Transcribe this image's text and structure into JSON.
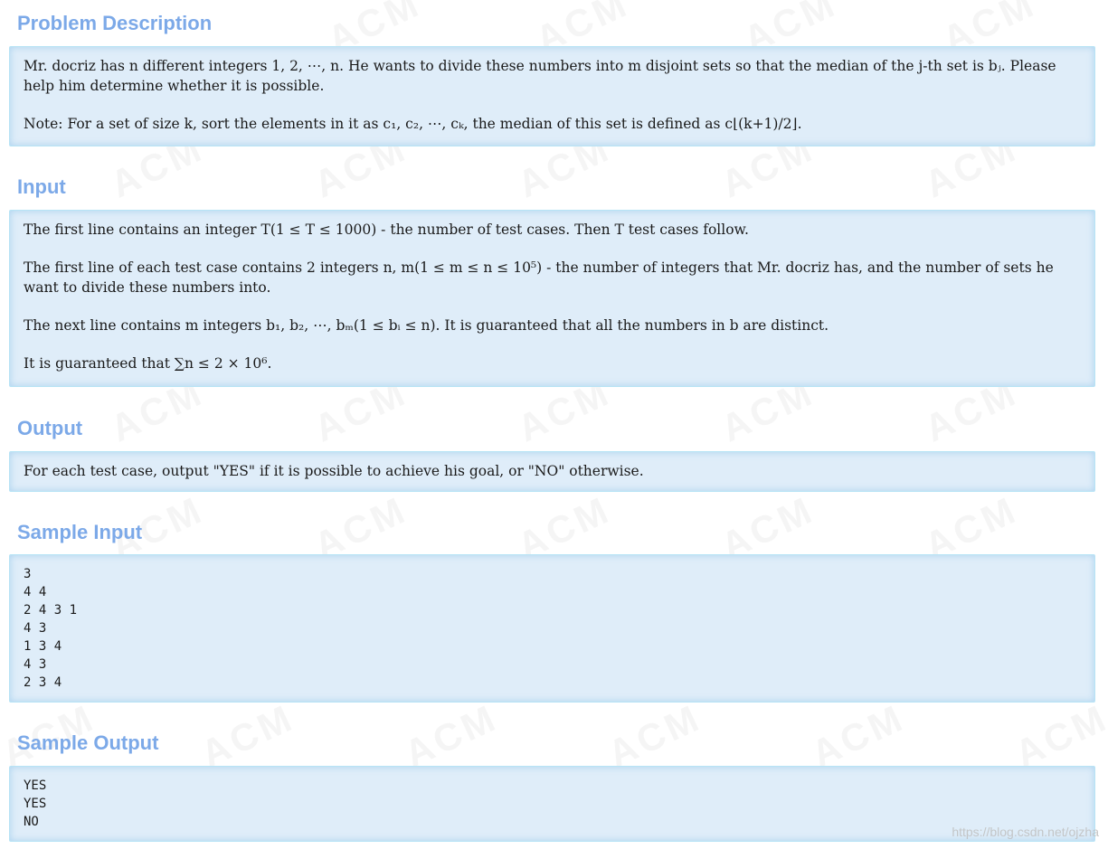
{
  "sections": {
    "problem": {
      "title": "Problem Description",
      "p1": "Mr. docriz has n different integers 1, 2, ⋯, n. He wants to divide these numbers into m disjoint sets so that the median of the j-th set is bⱼ. Please help him determine whether it is possible.",
      "p2": "Note: For a set of size k, sort the elements in it as c₁, c₂, ⋯, cₖ, the median of this set is defined as c⌊(k+1)/2⌋."
    },
    "input": {
      "title": "Input",
      "p1": "The first line contains an integer T(1 ≤ T ≤ 1000) - the number of test cases. Then T test cases follow.",
      "p2": "The first line of each test case contains 2 integers n, m(1 ≤ m ≤ n ≤ 10⁵) - the number of integers that Mr. docriz has, and the number of sets he want to divide these numbers into.",
      "p3": "The next line contains m integers b₁, b₂, ⋯, bₘ(1 ≤ bᵢ ≤ n). It is guaranteed that all the numbers in b are distinct.",
      "p4": "It is guaranteed that ∑n ≤ 2 × 10⁶."
    },
    "output": {
      "title": "Output",
      "p1": "For each test case, output \"YES\" if it is possible to achieve his goal, or \"NO\" otherwise."
    },
    "sample_input": {
      "title": "Sample Input",
      "text": "3\n4 4\n2 4 3 1\n4 3\n1 3 4\n4 3\n2 3 4"
    },
    "sample_output": {
      "title": "Sample Output",
      "text": "YES\nYES\nNO"
    }
  },
  "watermark_text": "ACM",
  "footer": {
    "url": "https://blog.csdn.net/ojzha"
  }
}
